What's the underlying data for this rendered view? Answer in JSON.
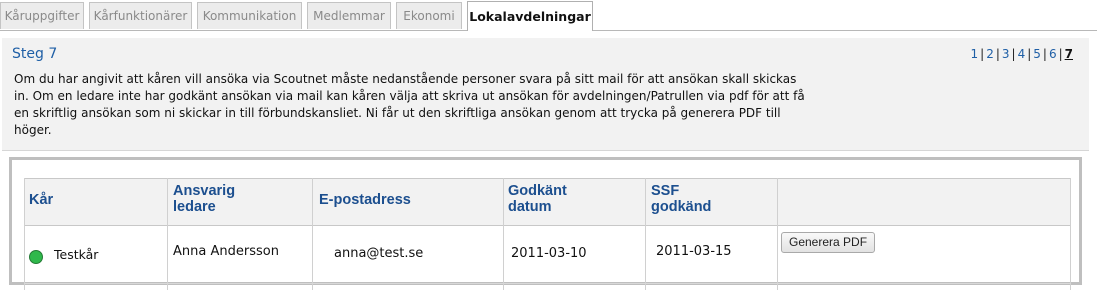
{
  "tabs": [
    {
      "label": "Kåruppgifter",
      "active": false
    },
    {
      "label": "Kårfunktionärer",
      "active": false
    },
    {
      "label": "Kommunikation",
      "active": false
    },
    {
      "label": "Medlemmar",
      "active": false
    },
    {
      "label": "Ekonomi",
      "active": false
    },
    {
      "label": "Lokalavdelningar",
      "active": true
    }
  ],
  "step": {
    "title": "Steg 7",
    "pages": [
      "1",
      "2",
      "3",
      "4",
      "5",
      "6",
      "7"
    ],
    "current_page": "7",
    "description": "Om du har angivit att kåren vill ansöka via Scoutnet måste nedanstående personer svara på sitt mail för att ansökan skall skickas in. Om en ledare inte har godkänt ansökan via mail kan kåren välja att skriva ut ansökan för avdelningen/Patrullen via pdf för att få en skriftlig ansökan som ni skickar in till förbundskansliet. Ni får ut den skriftliga ansökan genom att trycka på generera PDF till höger."
  },
  "table": {
    "columns": {
      "kar": "Kår",
      "ansvarig_line1": "Ansvarig",
      "ansvarig_line2": "ledare",
      "email": "E-postadress",
      "godkant_line1": "Godkänt",
      "godkant_line2": "datum",
      "ssf_line1": "SSF",
      "ssf_line2": "godkänd"
    },
    "rows": [
      {
        "kar": "Testkår",
        "status_color": "#2fb84b",
        "ledare": "Anna Andersson",
        "email": "anna@test.se",
        "godkant_datum": "2011-03-10",
        "ssf_godkand": "2011-03-15",
        "action_label": "Generera PDF"
      }
    ]
  }
}
